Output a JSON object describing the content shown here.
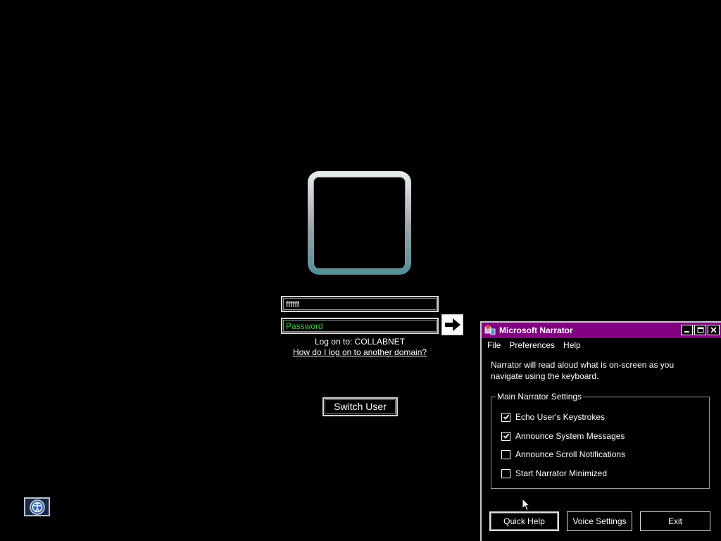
{
  "login": {
    "username_value": "ffffff",
    "password_placeholder": "Password",
    "logon_to": "Log on to: COLLABNET",
    "other_domain_link": "How do I log on to another domain?",
    "switch_user_label": "Switch User"
  },
  "narrator": {
    "title": "Microsoft Narrator",
    "menu": [
      "File",
      "Preferences",
      "Help"
    ],
    "description": "Narrator will read aloud what is on-screen as you navigate using the keyboard.",
    "group_title": "Main Narrator Settings",
    "options": [
      {
        "label": "Echo User's Keystrokes",
        "checked": true
      },
      {
        "label": "Announce System Messages",
        "checked": true
      },
      {
        "label": "Announce Scroll Notifications",
        "checked": false
      },
      {
        "label": "Start Narrator Minimized",
        "checked": false
      }
    ],
    "buttons": {
      "quick_help": "Quick Help",
      "voice_settings": "Voice Settings",
      "exit": "Exit"
    },
    "title_color": "#800080"
  },
  "icons": {
    "arrow": "arrow-right-icon",
    "ease": "ease-of-access-icon",
    "narrator": "narrator-app-icon"
  }
}
